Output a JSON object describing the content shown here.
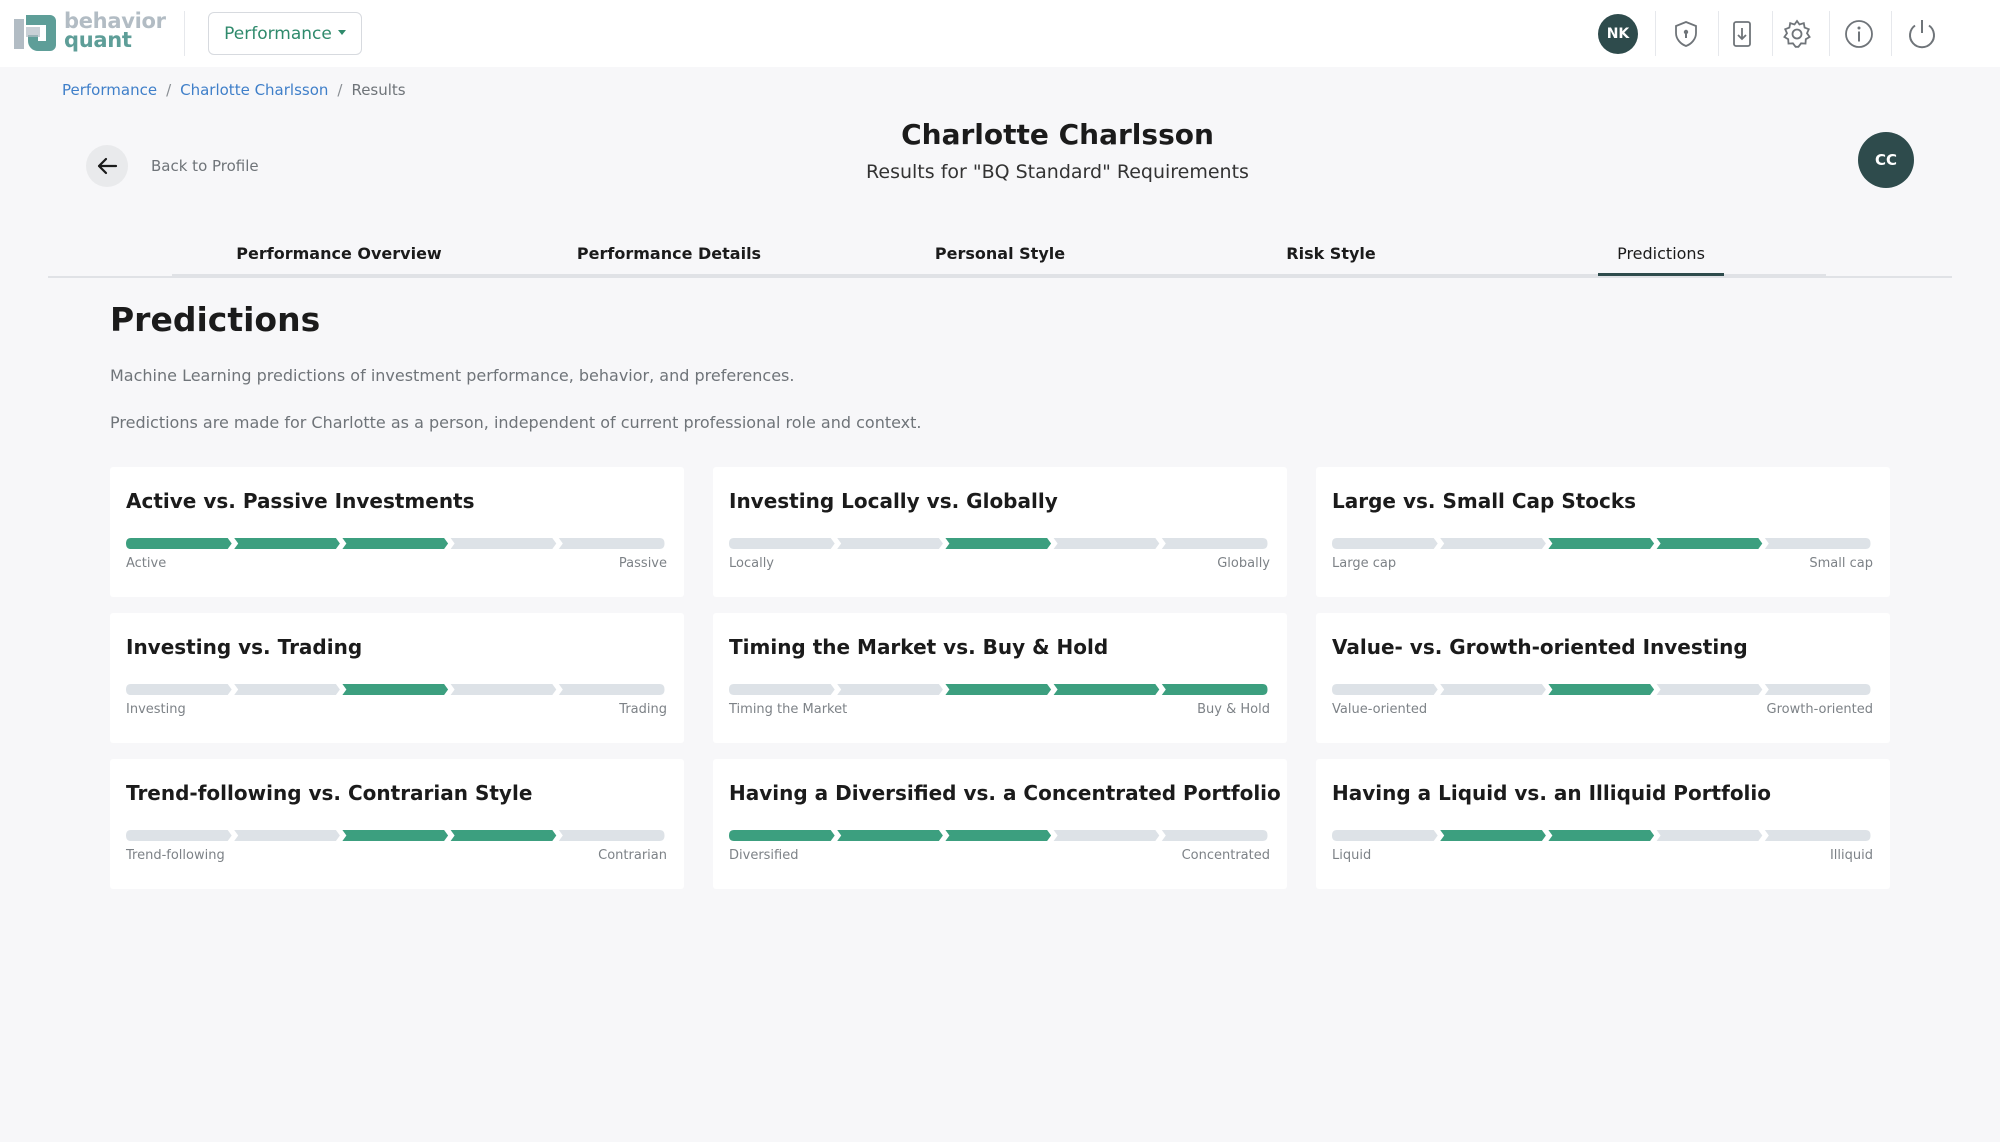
{
  "app": {
    "logo_line1": "behavior",
    "logo_line2": "quant",
    "menu_label": "Performance",
    "user_initials": "NK",
    "icons": [
      "shield-icon",
      "download-icon",
      "gear-icon",
      "info-icon",
      "power-icon"
    ]
  },
  "breadcrumb": {
    "items": [
      "Performance",
      "Charlotte Charlsson",
      "Results"
    ],
    "separator": "/"
  },
  "header": {
    "back_label": "Back to Profile",
    "name": "Charlotte Charlsson",
    "subtitle": "Results for \"BQ Standard\" Requirements",
    "avatar_initials": "CC"
  },
  "tabs": [
    {
      "label": "Performance Overview",
      "active": false
    },
    {
      "label": "Performance Details",
      "active": false
    },
    {
      "label": "Personal Style",
      "active": false
    },
    {
      "label": "Risk Style",
      "active": false
    },
    {
      "label": "Predictions",
      "active": true
    }
  ],
  "section": {
    "title": "Predictions",
    "desc1": "Machine Learning predictions of investment performance, behavior, and preferences.",
    "desc2": "Predictions are made for Charlotte as a person, independent of current professional role and context."
  },
  "colors": {
    "accent": "#3c9f7f",
    "inactive": "#dde2e7",
    "dark": "#2e4b4c",
    "link": "#3f7fc9"
  },
  "cards": [
    {
      "title": "Active vs. Passive Investments",
      "left": "Active",
      "right": "Passive",
      "filled": [
        1,
        2,
        3
      ]
    },
    {
      "title": "Investing Locally vs. Globally",
      "left": "Locally",
      "right": "Globally",
      "filled": [
        3
      ]
    },
    {
      "title": "Large vs. Small Cap Stocks",
      "left": "Large cap",
      "right": "Small cap",
      "filled": [
        3,
        4
      ]
    },
    {
      "title": "Investing vs. Trading",
      "left": "Investing",
      "right": "Trading",
      "filled": [
        3
      ]
    },
    {
      "title": "Timing the Market vs. Buy & Hold",
      "left": "Timing the Market",
      "right": "Buy & Hold",
      "filled": [
        3,
        4,
        5
      ]
    },
    {
      "title": "Value- vs. Growth-oriented Investing",
      "left": "Value-oriented",
      "right": "Growth-oriented",
      "filled": [
        3
      ]
    },
    {
      "title": "Trend-following vs. Contrarian Style",
      "left": "Trend-following",
      "right": "Contrarian",
      "filled": [
        3,
        4
      ]
    },
    {
      "title": "Having a Diversified vs. a Concentrated Portfolio",
      "left": "Diversified",
      "right": "Concentrated",
      "filled": [
        1,
        2,
        3
      ]
    },
    {
      "title": "Having a Liquid vs. an Illiquid Portfolio",
      "left": "Liquid",
      "right": "Illiquid",
      "filled": [
        2,
        3
      ]
    }
  ]
}
